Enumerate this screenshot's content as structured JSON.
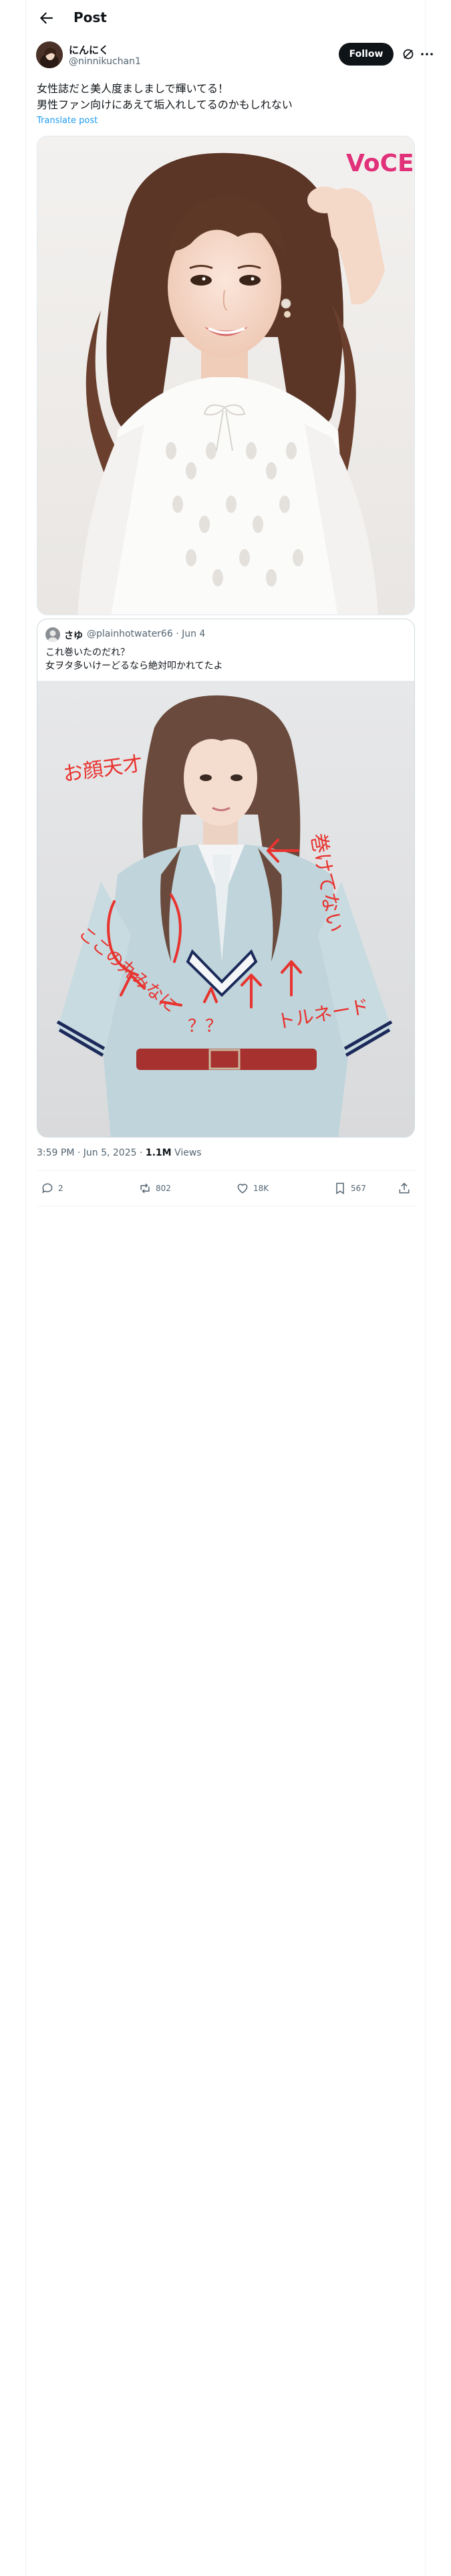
{
  "header": {
    "title": "Post"
  },
  "author": {
    "name": "にんにく",
    "handle": "@ninnikuchan1",
    "follow_label": "Follow"
  },
  "post": {
    "text_line1": "女性誌だと美人度ましましで輝いてる！",
    "text_line2": "男性ファン向けにあえて垢入れしてるのかもしれない",
    "translate_label": "Translate post",
    "image_logo": "VoCE"
  },
  "quote": {
    "name": "さゆ",
    "meta": "@plainhotwater66 · Jun 4",
    "text_line1": "これ巻いたのだれ？",
    "text_line2": "女ヲタ多いけーどるなら絶対叩かれてたよ",
    "annotations": [
      "お顔天才",
      "巻けてない",
      "ここの丸みなに",
      "？？",
      "トルネード"
    ]
  },
  "meta": {
    "time_date": "3:59 PM · Jun 5, 2025 · ",
    "views_count": "1.1M",
    "views_label": " Views"
  },
  "actions": {
    "replies": "2",
    "reposts": "802",
    "likes": "18K",
    "bookmarks": "567"
  },
  "colors": {
    "follow_bg": "#0f1419",
    "link": "#1d9bf0",
    "muted": "#536471",
    "annotation": "#e8332e"
  }
}
